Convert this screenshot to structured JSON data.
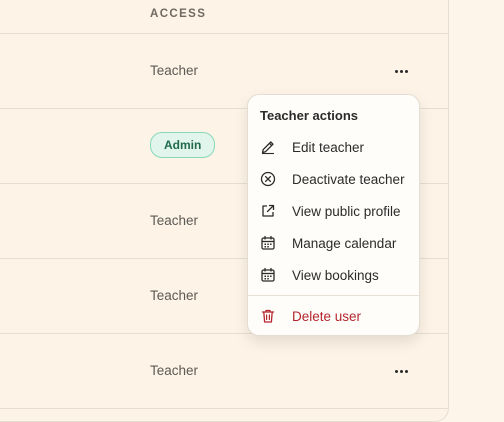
{
  "table": {
    "header_access": "ACCESS",
    "rows": [
      {
        "role": "Teacher",
        "type": "text",
        "menu": true
      },
      {
        "role": "Admin",
        "type": "badge",
        "menu": false
      },
      {
        "role": "Teacher",
        "type": "text",
        "menu": false
      },
      {
        "role": "Teacher",
        "type": "text",
        "menu": false
      },
      {
        "role": "Teacher",
        "type": "text",
        "menu": true
      }
    ]
  },
  "menu": {
    "title": "Teacher actions",
    "items": [
      {
        "label": "Edit teacher",
        "icon": "pencil-icon"
      },
      {
        "label": "Deactivate teacher",
        "icon": "circle-x-icon"
      },
      {
        "label": "View public profile",
        "icon": "external-link-icon"
      },
      {
        "label": "Manage calendar",
        "icon": "calendar-icon"
      },
      {
        "label": "View bookings",
        "icon": "calendar-icon"
      }
    ],
    "danger_item": {
      "label": "Delete user",
      "icon": "trash-icon"
    }
  },
  "colors": {
    "page_bg": "#fdf5ea",
    "badge_bg": "#e2f5ec",
    "badge_border": "#87d8b6",
    "badge_text": "#1f6b4c",
    "danger": "#b3262e"
  }
}
